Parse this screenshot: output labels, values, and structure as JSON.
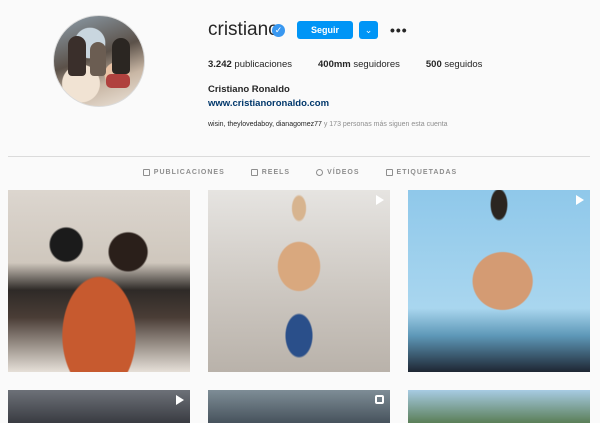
{
  "profile": {
    "username": "cristiano",
    "verified_symbol": "✓",
    "follow_label": "Seguir",
    "dropdown_symbol": "⌄",
    "more_symbol": "•••",
    "full_name": "Cristiano Ronaldo",
    "website": "www.cristianoronaldo.com",
    "followed_by_names": "wisin, theylovedaboy, dianagomez77",
    "followed_by_rest": " y 173 personas más siguen esta cuenta"
  },
  "stats": [
    {
      "count": "3.242",
      "label": " publicaciones"
    },
    {
      "count": "400mm",
      "label": " seguidores"
    },
    {
      "count": "500",
      "label": " seguidos"
    }
  ],
  "tabs": [
    {
      "label": "PUBLICACIONES",
      "icon": "grid-icon"
    },
    {
      "label": "REELS",
      "icon": "reels-icon"
    },
    {
      "label": "VÍDEOS",
      "icon": "video-icon"
    },
    {
      "label": "ETIQUETADAS",
      "icon": "tag-icon"
    }
  ],
  "colors": {
    "accent": "#0095f6",
    "verified": "#3897f0",
    "link": "#00376b"
  }
}
